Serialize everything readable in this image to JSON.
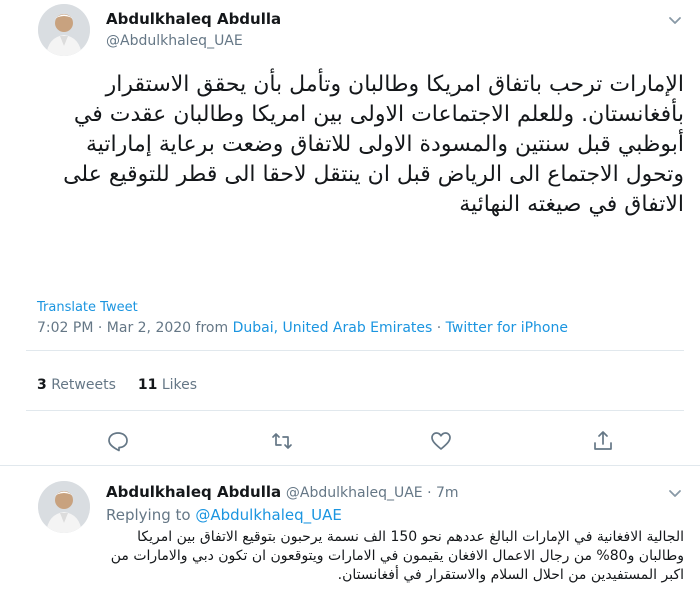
{
  "tweet": {
    "author_name": "Abdulkhaleq Abdulla",
    "author_handle": "@Abdulkhaleq_UAE",
    "text": "الإمارات ترحب باتفاق امريكا وطالبان وتأمل بأن يحقق الاستقرار بأفغانستان. وللعلم الاجتماعات الاولى بين امريكا وطالبان عقدت في أبوظبي قبل سنتين والمسودة الاولى للاتفاق وضعت برعاية إماراتية وتحول الاجتماع الى الرياض قبل ان ينتقل لاحقا الى قطر للتوقيع على الاتفاق في صيغته النهائية",
    "translate_label": "Translate Tweet",
    "time": "7:02 PM",
    "sep": " · ",
    "date": "Mar 2, 2020",
    "from_label": " from ",
    "location": "Dubai, United Arab Emirates",
    "source": "Twitter for iPhone",
    "retweets_count": "3",
    "retweets_label": "Retweets",
    "likes_count": "11",
    "likes_label": "Likes",
    "icons": {
      "caret": "chevron-down-icon",
      "reply": "reply-icon",
      "retweet": "retweet-icon",
      "like": "heart-icon",
      "share": "share-icon"
    }
  },
  "reply": {
    "author_name": "Abdulkhaleq Abdulla",
    "author_handle": "@Abdulkhaleq_UAE",
    "sep": " · ",
    "age": "7m",
    "replying_to_label": "Replying to ",
    "replying_to_handle": "@Abdulkhaleq_UAE",
    "text": "الجالية الافغانية في الإمارات البالغ عددهم نحو 150 الف نسمة يرحبون بتوقيع الاتفاق بين امريكا وطالبان و80% من رجال الاعمال الافغان يقيمون في الامارات ويتوقعون ان تكون دبي والامارات من اكبر المستفيدين من احلال السلام والاستقرار في أفغانستان."
  },
  "colors": {
    "text": "#14171a",
    "secondary": "#657786",
    "link": "#1b95e0",
    "border": "#e1e8ed"
  }
}
